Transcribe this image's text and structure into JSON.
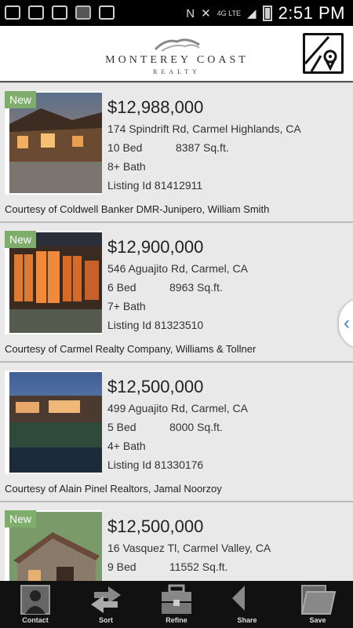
{
  "status_bar": {
    "time": "2:51 PM",
    "network": "4G LTE",
    "left_icons": [
      "storage-icon",
      "calendar-icon",
      "gmail-icon",
      "gallery-icon",
      "gmail-icon"
    ],
    "right_icons": [
      "nfc-icon",
      "mute-icon",
      "signal-icon",
      "battery-icon"
    ]
  },
  "header": {
    "brand": "MONTEREY COAST",
    "brand_sub": "REALTY",
    "map_icon": "map-pin-icon"
  },
  "listings": [
    {
      "badge": "New",
      "price": "$12,988,000",
      "address": "174 Spindrift Rd, Carmel Highlands, CA",
      "beds": "10 Bed",
      "sqft": "8387 Sq.ft.",
      "baths": "8+ Bath",
      "listing_id": "Listing Id 81412911",
      "courtesy": "Courtesy of Coldwell Banker DMR-Junipero, William Smith"
    },
    {
      "badge": "New",
      "price": "$12,900,000",
      "address": "546 Aguajito Rd, Carmel, CA",
      "beds": "6 Bed",
      "sqft": "8963 Sq.ft.",
      "baths": "7+ Bath",
      "listing_id": "Listing Id 81323510",
      "courtesy": "Courtesy of Carmel Realty Company, Williams & Tollner"
    },
    {
      "badge": "",
      "price": "$12,500,000",
      "address": "499 Aguajito Rd, Carmel, CA",
      "beds": "5 Bed",
      "sqft": "8000 Sq.ft.",
      "baths": "4+ Bath",
      "listing_id": "Listing Id 81330176",
      "courtesy": "Courtesy of Alain Pinel Realtors, Jamal Noorzoy"
    },
    {
      "badge": "New",
      "price": "$12,500,000",
      "address": "16 Vasquez Tl,  Carmel Valley, CA",
      "beds": "9 Bed",
      "sqft": "11552 Sq.ft.",
      "baths": "",
      "listing_id": "",
      "courtesy": ""
    }
  ],
  "side_tab": {
    "glyph": "‹"
  },
  "bottom_nav": [
    {
      "label": "Contact",
      "icon": "contact-icon"
    },
    {
      "label": "Sort",
      "icon": "sort-arrows-icon"
    },
    {
      "label": "Refine",
      "icon": "toolbox-icon"
    },
    {
      "label": "Share",
      "icon": "share-arrow-icon"
    },
    {
      "label": "Save",
      "icon": "folder-icon"
    }
  ],
  "colors": {
    "badge": "#7fae6c",
    "side_tab_arrow": "#3a86c8",
    "nav_background": "#111111",
    "list_background": "#e9e9e9"
  }
}
